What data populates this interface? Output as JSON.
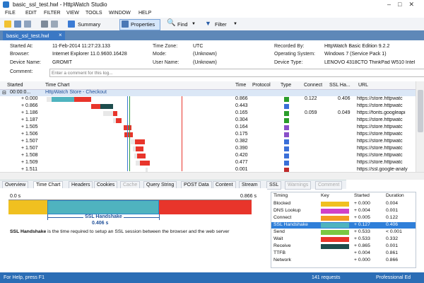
{
  "window": {
    "title": "basic_ssl_test.hwl - HttpWatch Studio"
  },
  "menu": [
    "FILE",
    "EDIT",
    "FILTER",
    "VIEW",
    "TOOLS",
    "WINDOW",
    "HELP"
  ],
  "toolbar": {
    "summary": "Summary",
    "properties": "Properties",
    "find": "Find",
    "filter": "Filter"
  },
  "doc_tab": {
    "label": "basic_ssl_test.hwl",
    "close": "×"
  },
  "info": {
    "started_at_label": "Started At:",
    "started_at": "11-Feb-2014 11:27:23.133",
    "browser_label": "Browser:",
    "browser": "Internet Explorer 11.0.9600.16428",
    "device_name_label": "Device Name:",
    "device_name": "GROMIT",
    "comment_label": "Comment:",
    "comment_placeholder": "Enter a comment for this log...",
    "time_zone_label": "Time Zone:",
    "time_zone": "UTC",
    "mode_label": "Mode:",
    "mode": "(Unknown)",
    "user_name_label": "User Name:",
    "user_name": "(Unknown)",
    "recorded_by_label": "Recorded By:",
    "recorded_by": "HttpWatch Basic Edition 9.2.2",
    "os_label": "Operating System:",
    "os": "Windows 7 (Service Pack 1)",
    "device_type_label": "Device Type:",
    "device_type": "LENOVO 4318CTO ThinkPad W510 Intel"
  },
  "grid": {
    "headers": {
      "started": "Started",
      "time_chart": "Time Chart",
      "time": "Time",
      "protocol": "Protocol",
      "type": "Type",
      "connect": "Connect",
      "ssl": "SSL Ha...",
      "url": "URL"
    },
    "group": {
      "started": "00:00:0...",
      "label": "HttpWatch Store - Checkout"
    },
    "rows": [
      {
        "started": "+ 0.000",
        "time": "0.866",
        "connect": "0.122",
        "ssl": "0.406",
        "url": "https://store.httpwatc",
        "type_color": "#2a9d2a"
      },
      {
        "started": "+ 0.866",
        "time": "0.443",
        "connect": "",
        "ssl": "",
        "url": "https://store.httpwatc",
        "type_color": "#3a6fd8"
      },
      {
        "started": "+ 1.186",
        "time": "0.165",
        "connect": "0.059",
        "ssl": "0.049",
        "url": "https://fonts.googleapi",
        "type_color": "#2a9d2a"
      },
      {
        "started": "+ 1.187",
        "time": "0.304",
        "connect": "",
        "ssl": "",
        "url": "https://store.httpwatc",
        "type_color": "#2a9d2a"
      },
      {
        "started": "+ 1.505",
        "time": "0.164",
        "connect": "",
        "ssl": "",
        "url": "https://store.httpwatc",
        "type_color": "#8a4fc9"
      },
      {
        "started": "+ 1.506",
        "time": "0.175",
        "connect": "",
        "ssl": "",
        "url": "https://store.httpwatc",
        "type_color": "#8a4fc9"
      },
      {
        "started": "+ 1.507",
        "time": "0.382",
        "connect": "",
        "ssl": "",
        "url": "https://store.httpwatc",
        "type_color": "#3a6fd8"
      },
      {
        "started": "+ 1.507",
        "time": "0.390",
        "connect": "",
        "ssl": "",
        "url": "https://store.httpwatc",
        "type_color": "#3a6fd8"
      },
      {
        "started": "+ 1.508",
        "time": "0.420",
        "connect": "",
        "ssl": "",
        "url": "https://store.httpwatc",
        "type_color": "#3a6fd8"
      },
      {
        "started": "+ 1.509",
        "time": "0.477",
        "connect": "",
        "ssl": "",
        "url": "https://store.httpwatc",
        "type_color": "#3a6fd8"
      },
      {
        "started": "+ 1.511",
        "time": "0.001",
        "connect": "",
        "ssl": "",
        "url": "https://ssl.google-analy",
        "type_color": "#c02a2a"
      }
    ]
  },
  "bottom_tabs": [
    "Overview",
    "Time Chart",
    "Headers",
    "Cookies",
    "Cache",
    "Query String",
    "POST Data",
    "Content",
    "Stream",
    "SSL",
    "Warnings",
    "Comment"
  ],
  "detail": {
    "scale_start": "0.0 s",
    "scale_end": "0.866 s",
    "callout_title": "SSL Handshake",
    "callout_value": "0.406 s",
    "desc_bold": "SSL Handshake",
    "desc_rest": " is the time required to setup an SSL session between the browser and the web server"
  },
  "legend": {
    "headers": {
      "timing": "Timing",
      "key": "Key",
      "started": "Started",
      "duration": "Duration"
    },
    "rows": [
      {
        "timing": "Blocked",
        "color": "#f0c020",
        "started": "+ 0.000",
        "duration": "0.004"
      },
      {
        "timing": "DNS Lookup",
        "color": "#d040c8",
        "started": "+ 0.004",
        "duration": "0.001"
      },
      {
        "timing": "Connect",
        "color": "#f39a22",
        "started": "+ 0.005",
        "duration": "0.122"
      },
      {
        "timing": "SSL Handshake",
        "color": "#4fb3bf",
        "started": "+ 0.127",
        "duration": "0.406"
      },
      {
        "timing": "Send",
        "color": "#7ac943",
        "started": "+ 0.533",
        "duration": "< 0.001"
      },
      {
        "timing": "Wait",
        "color": "#e8352b",
        "started": "+ 0.533",
        "duration": "0.332"
      },
      {
        "timing": "Receive",
        "color": "#1e4d4d",
        "started": "+ 0.865",
        "duration": "0.001"
      },
      {
        "timing": "TTFB",
        "color": "",
        "started": "+ 0.004",
        "duration": "0.861"
      },
      {
        "timing": "Network",
        "color": "",
        "started": "+ 0.000",
        "duration": "0.866"
      }
    ]
  },
  "status": {
    "left": "For Help, press F1",
    "requests": "141 requests",
    "edition": "Professional Ed"
  }
}
